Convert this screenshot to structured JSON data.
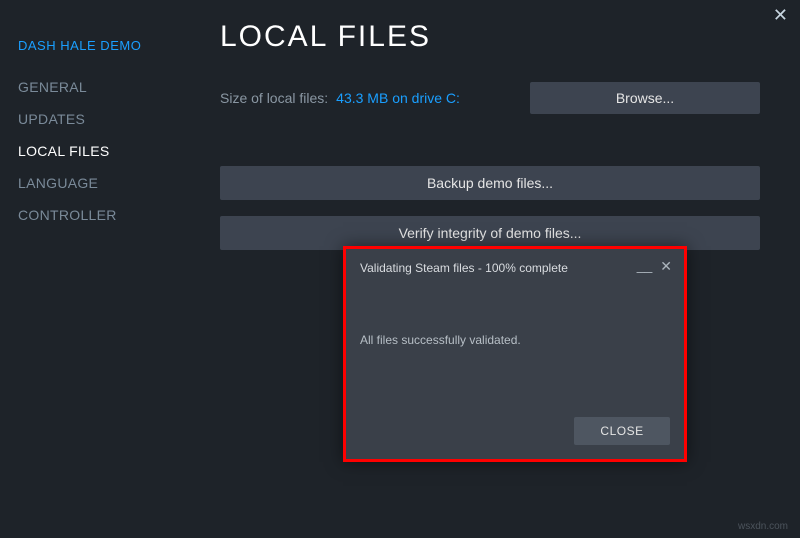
{
  "game_title": "DASH HALE DEMO",
  "sidebar": {
    "items": [
      {
        "label": "GENERAL"
      },
      {
        "label": "UPDATES"
      },
      {
        "label": "LOCAL FILES"
      },
      {
        "label": "LANGUAGE"
      },
      {
        "label": "CONTROLLER"
      }
    ],
    "active_index": 2
  },
  "page": {
    "title": "LOCAL FILES",
    "size_label": "Size of local files:",
    "size_value": "43.3 MB on drive C:",
    "browse_label": "Browse...",
    "backup_label": "Backup demo files...",
    "verify_label": "Verify integrity of demo files..."
  },
  "dialog": {
    "title": "Validating Steam files - 100% complete",
    "message": "All files successfully validated.",
    "close_label": "CLOSE"
  },
  "watermark": "wsxdn.com"
}
